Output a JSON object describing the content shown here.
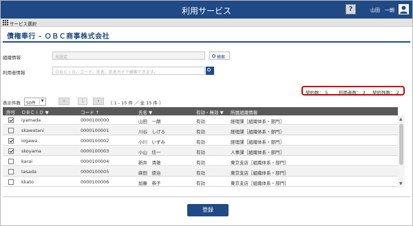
{
  "app": {
    "title": "利用サービス"
  },
  "header": {
    "help_label": "?",
    "user_name": "山田　一朗"
  },
  "subbar": {
    "label": "サービス選択"
  },
  "page": {
    "title": "債権奉行 - ＯＢＣ商事株式会社"
  },
  "filters": {
    "org_label": "組織情報",
    "org_placeholder": "未設定",
    "search_button_label": "検索",
    "user_label": "利用者情報",
    "user_placeholder": "ＯＢＣｉＤ、コード、氏名、氏名カナで検索できます。"
  },
  "summary": {
    "contracts": "契約数： 5",
    "users": "利用者数： 3",
    "remaining": "契約残数： 2"
  },
  "pager": {
    "label": "表示件数",
    "per_page": "50件",
    "prev": "‹",
    "page": "1",
    "next": "›",
    "info": "（ 1 - 15 件 ／ 全 15 件 ）"
  },
  "table": {
    "headers": [
      "許可",
      "ＯＢＣｉＤ ▼",
      "コード ↑",
      "氏名 ▼",
      "有効・無効 ▼",
      "所属組織情報"
    ],
    "rows": [
      {
        "checked": true,
        "obcid": "iyamada",
        "code": "0000100000",
        "name": "山田　一朗",
        "status": "有効",
        "org": "経理課［組織体系・部門］"
      },
      {
        "checked": false,
        "obcid": "skawatani",
        "code": "0000100001",
        "name": "川谷　しげる",
        "status": "有効",
        "org": "経理課［組織体系・部門］"
      },
      {
        "checked": true,
        "obcid": "iogawa",
        "code": "0000100002",
        "name": "小川　いずみ",
        "status": "有効",
        "org": "経理課［組織体系・部門］"
      },
      {
        "checked": true,
        "obcid": "skoyama",
        "code": "0000100003",
        "name": "小山　信一",
        "status": "有効",
        "org": "人事課［組織体系・部門］"
      },
      {
        "checked": false,
        "obcid": "karai",
        "code": "0000100004",
        "name": "新井　清雄",
        "status": "有効",
        "org": "東京支店［組織体系・部門］"
      },
      {
        "checked": false,
        "obcid": "tasada",
        "code": "0000100005",
        "name": "麻田　徳治",
        "status": "有効",
        "org": "東京支店［組織体系・部門］"
      },
      {
        "checked": false,
        "obcid": "kkato",
        "code": "0000100006",
        "name": "加藤　恭子",
        "status": "有効",
        "org": "東京支店［組織体系・部門］"
      }
    ]
  },
  "footer": {
    "register_label": "登録"
  },
  "icons": {
    "help": "help-icon",
    "user": "user-icon",
    "grid": "grid-icon",
    "search": "search-icon"
  },
  "colors": {
    "brand": "#1f4a85",
    "highlight": "#d40000"
  }
}
